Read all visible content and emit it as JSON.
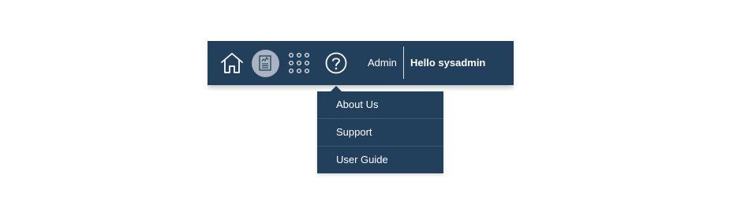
{
  "topbar": {
    "icons": {
      "home": "home-icon",
      "dashboard": "dashboard-icon",
      "apps": "apps-grid-icon",
      "help": "help-icon"
    },
    "admin_label": "Admin",
    "greeting": "Hello sysadmin"
  },
  "help_menu": {
    "items": [
      {
        "label": "About Us"
      },
      {
        "label": "Support"
      },
      {
        "label": "User Guide"
      }
    ]
  },
  "colors": {
    "bar_background": "#22405b",
    "active_icon_background": "#a9b4c0",
    "text": "#ffffff"
  }
}
